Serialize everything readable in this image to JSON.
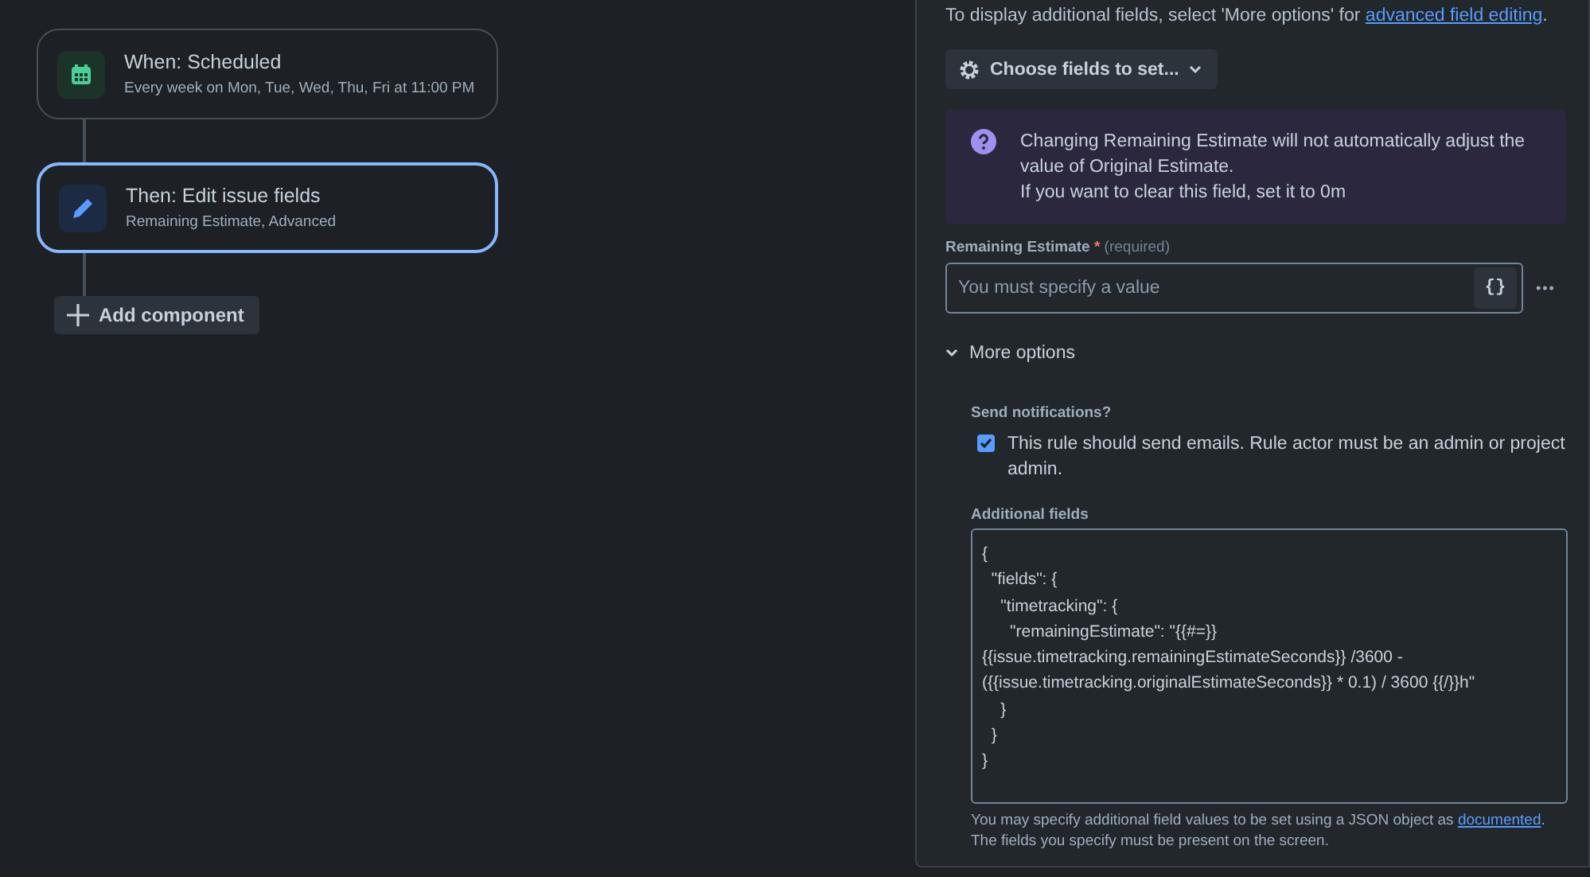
{
  "flow": {
    "trigger": {
      "title": "When: Scheduled",
      "subtitle": "Every week on Mon, Tue, Wed, Thu, Fri at 11:00 PM",
      "selected": false
    },
    "action": {
      "title": "Then: Edit issue fields",
      "subtitle": "Remaining Estimate, Advanced",
      "selected": true
    },
    "add_button": "Add component"
  },
  "panel": {
    "intro": {
      "text": "To display additional fields, select 'More options' for ",
      "link": "advanced field editing",
      "end": "."
    },
    "choose_button": "Choose fields to set...",
    "info": [
      "Changing Remaining Estimate will not automatically adjust the value of Original Estimate.",
      "If you want to clear this field, set it to 0m"
    ],
    "field": {
      "label": "Remaining Estimate",
      "required_mark": "*",
      "required_note": "(required)",
      "placeholder": "You must specify a value",
      "smart_value_button": "{}",
      "more_button": "•••"
    },
    "more_options": {
      "label": "More options",
      "expanded": true
    },
    "notifications": {
      "label": "Send notifications?",
      "checkbox_label": "This rule should send emails. Rule actor must be an admin or project admin.",
      "checked": true
    },
    "additional_fields": {
      "label": "Additional fields",
      "value": "{\n  \"fields\": {\n    \"timetracking\": {\n      \"remainingEstimate\": \"{{#=}}\n{{issue.timetracking.remainingEstimateSeconds}} /3600 -\n({{issue.timetracking.originalEstimateSeconds}} * 0.1) / 3600 {{/}}h\"\n    }\n  }\n}"
    },
    "help": {
      "text": "You may specify additional field values to be set using a JSON object as ",
      "link": "documented",
      "end": ". The fields you specify must be present on the screen."
    }
  }
}
